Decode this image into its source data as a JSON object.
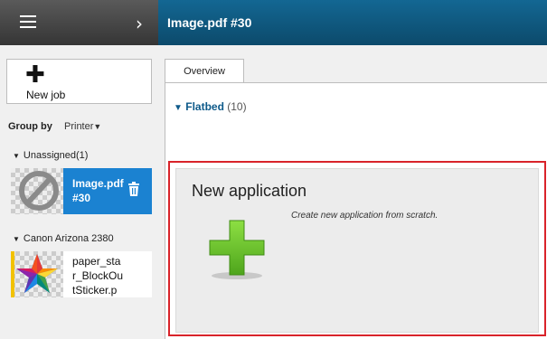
{
  "header": {
    "title": "Image.pdf #30"
  },
  "sidebar": {
    "new_job_label": "New job",
    "group_by_label": "Group by",
    "group_by_value": "Printer",
    "sections": [
      {
        "label": "Unassigned(1)",
        "jobs": [
          {
            "name_line1": "Image.pdf",
            "name_line2": "#30",
            "selected": true
          }
        ]
      },
      {
        "label": "Canon Arizona 2380",
        "jobs": [
          {
            "name_line1": "paper_sta",
            "name_line2": "r_BlockOu",
            "name_line3": "tSticker.p",
            "selected": false
          }
        ]
      }
    ]
  },
  "main": {
    "tab_label": "Overview",
    "group_label": "Flatbed",
    "group_count": "(10)",
    "new_app": {
      "title": "New application",
      "description": "Create new application from scratch."
    }
  },
  "colors": {
    "accent": "#1b82d1",
    "header_blue": "#0c4a6b",
    "highlight_red": "#d9232a",
    "plus_green": "#6cc02a"
  }
}
